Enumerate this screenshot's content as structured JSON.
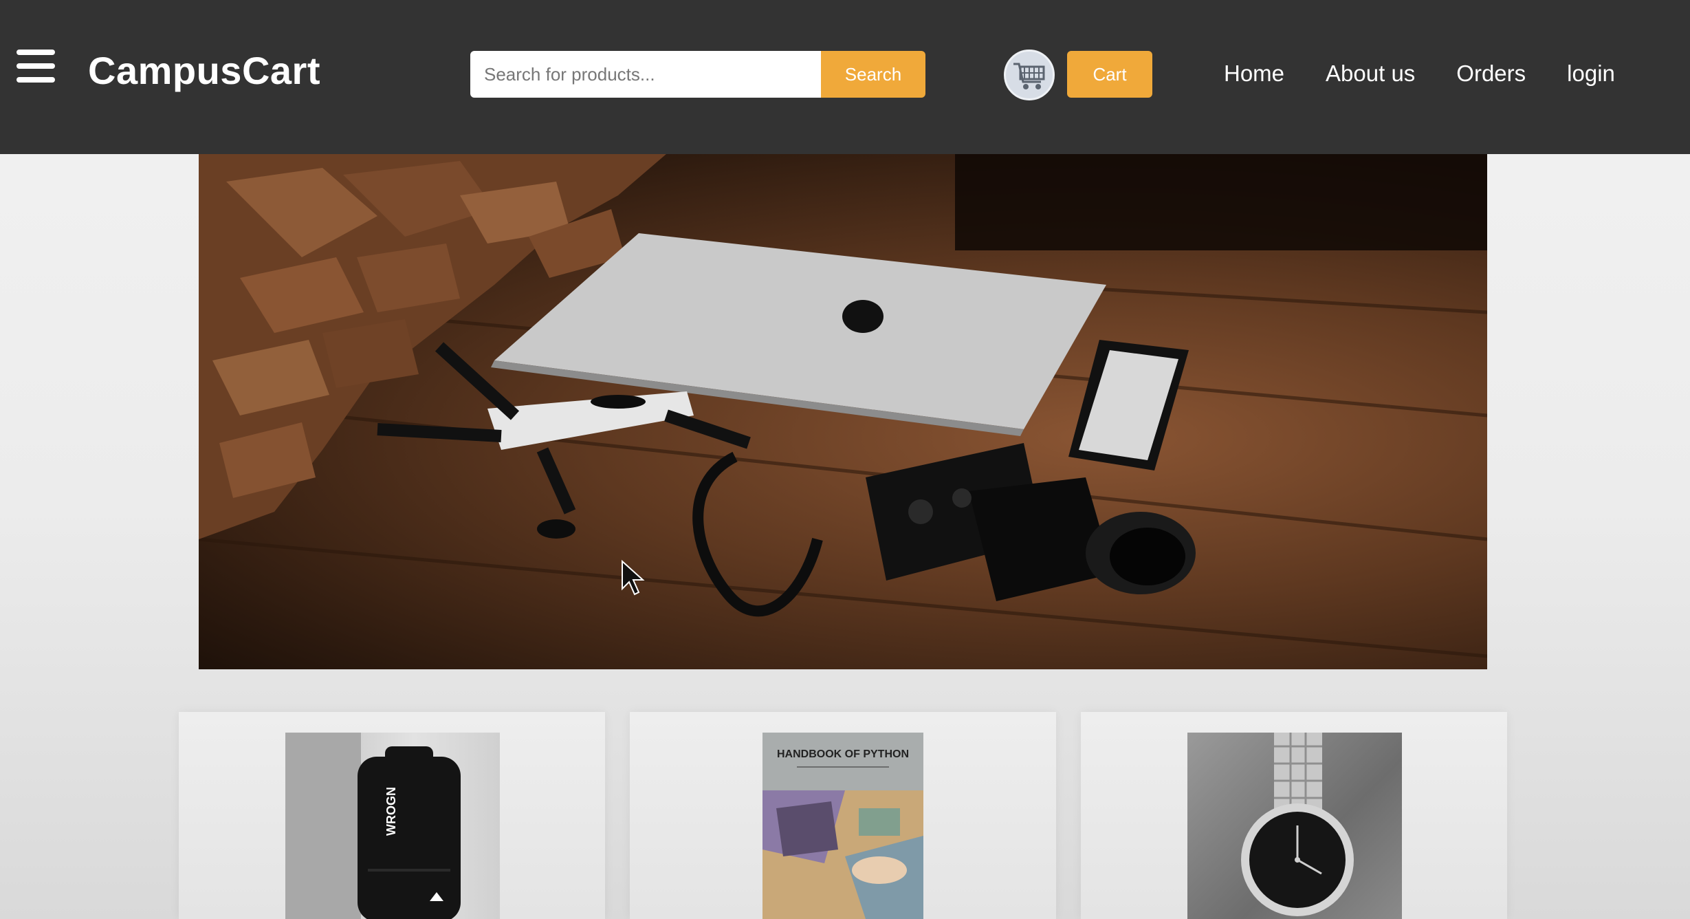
{
  "header": {
    "brand": "CampusCart",
    "search": {
      "placeholder": "Search for products...",
      "button_label": "Search"
    },
    "cart_label": "Cart",
    "nav": [
      {
        "label": "Home"
      },
      {
        "label": "About us"
      },
      {
        "label": "Orders"
      },
      {
        "label": "login"
      }
    ]
  },
  "hero": {
    "alt": "Laptop, drone, camera and phone on wooden table"
  },
  "products": [
    {
      "alt": "WROGN black backpack",
      "print": "WROGN"
    },
    {
      "alt": "Python handbook cover",
      "print": "HANDBOOK OF PYTHON"
    },
    {
      "alt": "Silver wrist watch"
    }
  ],
  "colors": {
    "header_bg": "#333333",
    "accent": "#f0a93a",
    "text_on_dark": "#ffffff"
  },
  "icons": [
    "hamburger-menu-icon",
    "shopping-cart-icon"
  ]
}
